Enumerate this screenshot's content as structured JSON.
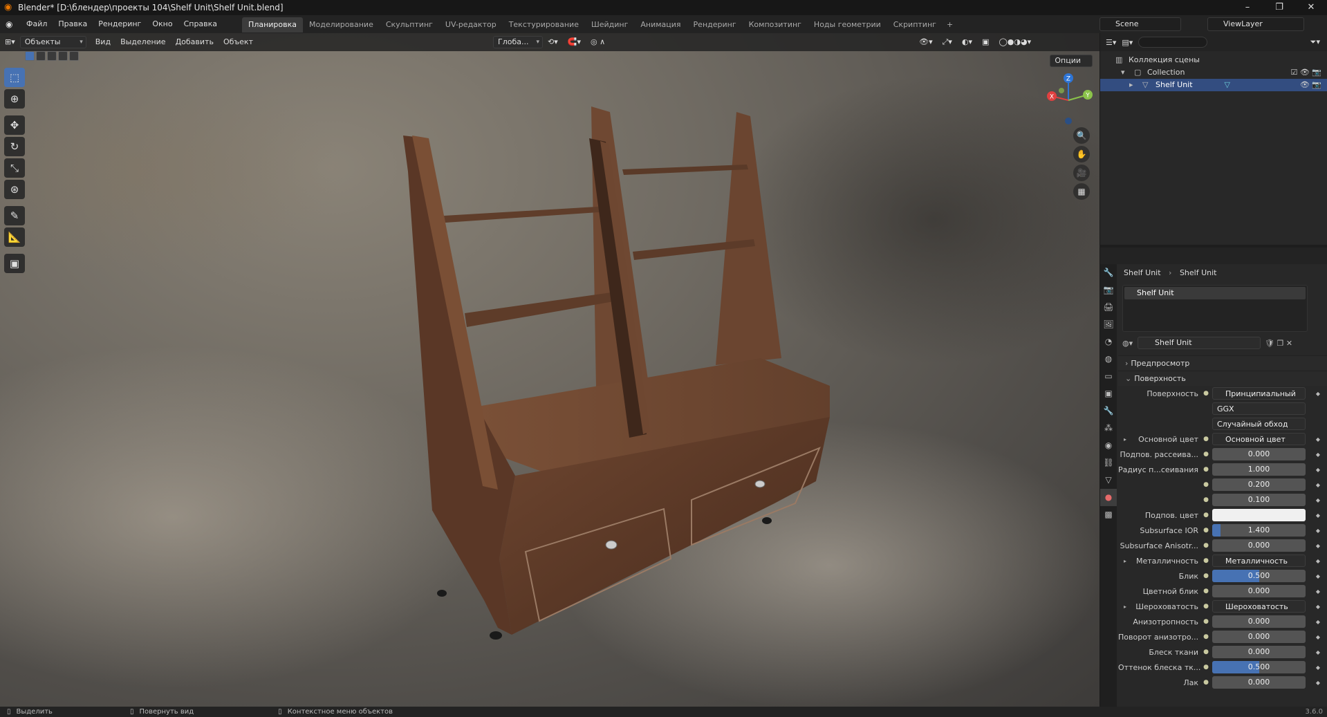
{
  "window": {
    "title": "Blender* [D:\\блендер\\проекты 104\\Shelf Unit\\Shelf Unit.blend]",
    "controls": [
      "–",
      "❐",
      "✕"
    ]
  },
  "menubar": {
    "menus": [
      "Файл",
      "Правка",
      "Рендеринг",
      "Окно",
      "Справка"
    ],
    "workspaces": [
      "Планировка",
      "Моделирование",
      "Скульптинг",
      "UV-редактор",
      "Текстурирование",
      "Шейдинг",
      "Анимация",
      "Рендеринг",
      "Композитинг",
      "Ноды геометрии",
      "Скриптинг"
    ],
    "active_workspace_index": 0,
    "scene": "Scene",
    "view_layer": "ViewLayer"
  },
  "viewport": {
    "mode": "Объекты",
    "menus": [
      "Вид",
      "Выделение",
      "Добавить",
      "Объект"
    ],
    "orientation": "Глоба...",
    "options": "Опции",
    "gizmo_axes": {
      "x": "X",
      "y": "Y",
      "z": "Z"
    }
  },
  "outliner": {
    "rows": [
      {
        "label": "Коллекция сцены",
        "icon": "scene-collection-icon"
      },
      {
        "label": "Collection",
        "icon": "collection-icon"
      },
      {
        "label": "Shelf Unit",
        "icon": "mesh-object-icon",
        "selected": true
      }
    ]
  },
  "properties": {
    "breadcrumb": {
      "object": "Shelf Unit",
      "material": "Shelf Unit"
    },
    "slot": "Shelf Unit",
    "material_name": "Shelf Unit",
    "panels": {
      "preview": "Предпросмотр",
      "surface": "Поверхность"
    },
    "rows": [
      {
        "label": "Поверхность",
        "value": "Принципиальный BSDF",
        "kind": "link"
      },
      {
        "label": "",
        "value": "GGX",
        "kind": "select"
      },
      {
        "label": "",
        "value": "Случайный обход",
        "kind": "select"
      },
      {
        "label": "Основной цвет",
        "value": "Основной цвет",
        "kind": "link",
        "expand": true
      },
      {
        "label": "Подпов. рассеива...",
        "value": "0.000",
        "kind": "num",
        "fill": 0
      },
      {
        "label": "Радиус п...сеивания",
        "value": "1.000",
        "kind": "num",
        "fill": 0
      },
      {
        "label": "",
        "value": "0.200",
        "kind": "num",
        "fill": 0
      },
      {
        "label": "",
        "value": "0.100",
        "kind": "num",
        "fill": 0
      },
      {
        "label": "Подпов. цвет",
        "value": "",
        "kind": "color"
      },
      {
        "label": "Subsurface IOR",
        "value": "1.400",
        "kind": "num",
        "fill": 0.09
      },
      {
        "label": "Subsurface Anisotr...",
        "value": "0.000",
        "kind": "num",
        "fill": 0
      },
      {
        "label": "Металличность",
        "value": "Металличность",
        "kind": "link",
        "expand": true
      },
      {
        "label": "Блик",
        "value": "0.500",
        "kind": "num",
        "fill": 0.5
      },
      {
        "label": "Цветной блик",
        "value": "0.000",
        "kind": "num",
        "fill": 0
      },
      {
        "label": "Шероховатость",
        "value": "Шероховатость",
        "kind": "link",
        "expand": true
      },
      {
        "label": "Анизотропность",
        "value": "0.000",
        "kind": "num",
        "fill": 0
      },
      {
        "label": "Поворот анизотро...",
        "value": "0.000",
        "kind": "num",
        "fill": 0
      },
      {
        "label": "Блеск ткани",
        "value": "0.000",
        "kind": "num",
        "fill": 0
      },
      {
        "label": "Оттенок блеска тк...",
        "value": "0.500",
        "kind": "num",
        "fill": 0.5
      },
      {
        "label": "Лак",
        "value": "0.000",
        "kind": "num",
        "fill": 0
      }
    ]
  },
  "statusbar": {
    "select": "Выделить",
    "rotate": "Повернуть вид",
    "context": "Контекстное меню объектов",
    "version": "3.6.0"
  }
}
